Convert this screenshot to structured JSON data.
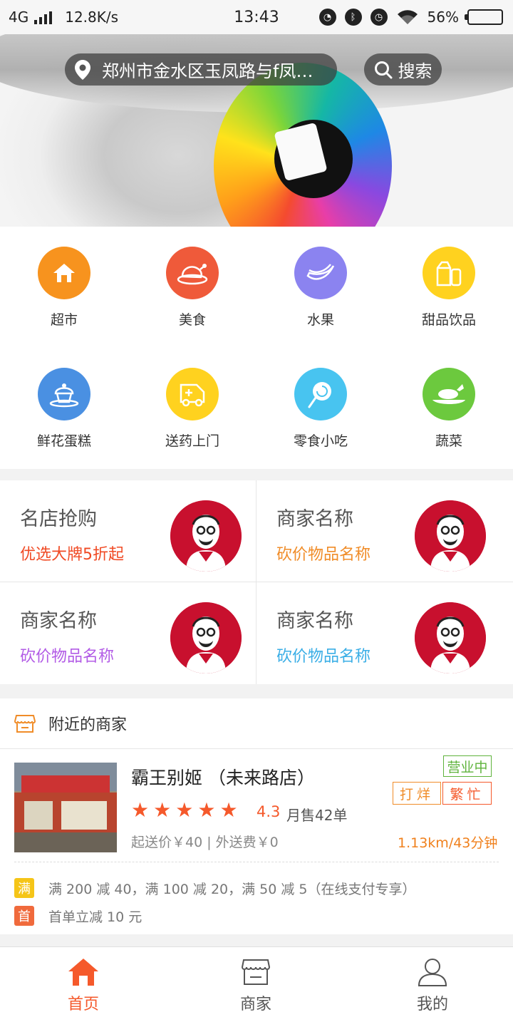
{
  "status_bar": {
    "network": "4G",
    "speed": "12.8K/s",
    "time": "13:43",
    "battery_percent": "56%",
    "battery_level": 0.56,
    "icons": [
      "nfc-icon",
      "bluetooth-icon",
      "alarm-icon",
      "wifi-icon"
    ]
  },
  "banner": {
    "location": "郑州市金水区玉凤路与f凤凰…",
    "search_label": "搜索",
    "slide_count": 6,
    "active_slide": 0
  },
  "categories": [
    {
      "label": "超市",
      "icon": "home-icon",
      "color": "#f7931e"
    },
    {
      "label": "美食",
      "icon": "roast-chicken-icon",
      "color": "#ef5a3a"
    },
    {
      "label": "水果",
      "icon": "banana-icon",
      "color": "#8b83f0"
    },
    {
      "label": "甜品饮品",
      "icon": "milk-carton-icon",
      "color": "#ffd21f"
    },
    {
      "label": "鲜花蛋糕",
      "icon": "cupcake-icon",
      "color": "#4a90e2"
    },
    {
      "label": "送药上门",
      "icon": "medicine-truck-icon",
      "color": "#ffd21f"
    },
    {
      "label": "零食小吃",
      "icon": "lollipop-icon",
      "color": "#48c4f0"
    },
    {
      "label": "蔬菜",
      "icon": "vegetable-icon",
      "color": "#6cc93e"
    }
  ],
  "promos": [
    {
      "title": "名店抢购",
      "subtitle": "优选大牌5折起",
      "color": "#f04a24",
      "logo": "kfc-logo"
    },
    {
      "title": "商家名称",
      "subtitle": "砍价物品名称",
      "color": "#f08c28",
      "logo": "kfc-logo"
    },
    {
      "title": "商家名称",
      "subtitle": "砍价物品名称",
      "color": "#b25be6",
      "logo": "kfc-logo"
    },
    {
      "title": "商家名称",
      "subtitle": "砍价物品名称",
      "color": "#3aaee6",
      "logo": "kfc-logo"
    }
  ],
  "nearby": {
    "header": "附近的商家",
    "shop": {
      "name": "霸王别姬 （未来路店）",
      "rating": "4.3",
      "stars": 5,
      "monthly_sales": "月售42单",
      "fees": "起送价￥40 | 外送费￥0",
      "status": "营业中",
      "tags": [
        "打烊",
        "繁忙"
      ],
      "distance": "1.13km/43分钟",
      "deals": [
        {
          "badge": "满",
          "color": "#f5c518",
          "text": "满 200 减 40，满 100 减 20，满 50 减 5（在线支付专享）"
        },
        {
          "badge": "首",
          "color": "#f06a3c",
          "text": "首单立减 10 元"
        }
      ]
    }
  },
  "tabbar": {
    "tabs": [
      {
        "label": "首页",
        "icon": "home-icon",
        "active": true
      },
      {
        "label": "商家",
        "icon": "store-icon",
        "active": false
      },
      {
        "label": "我的",
        "icon": "user-icon",
        "active": false
      }
    ],
    "accent": "#f5592b"
  }
}
